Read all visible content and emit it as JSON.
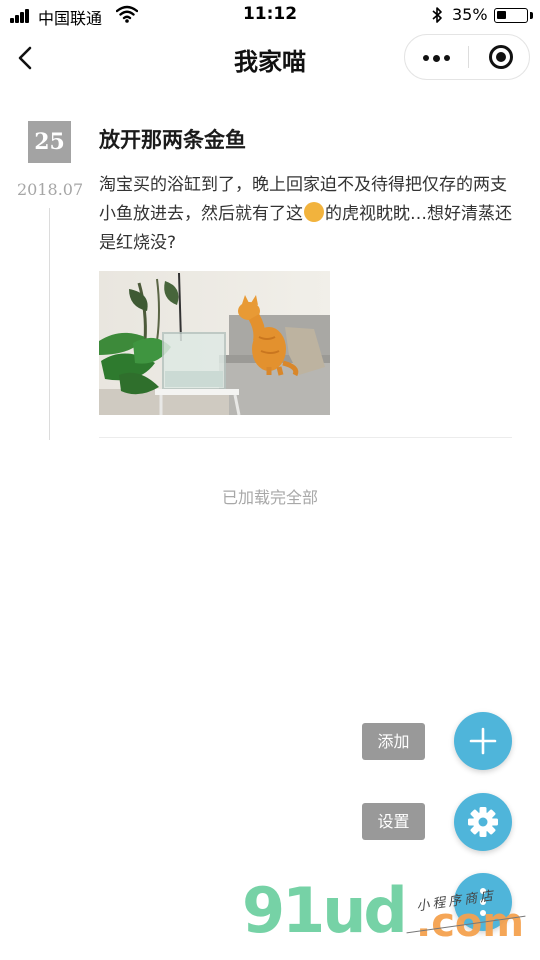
{
  "status_bar": {
    "carrier": "中国联通",
    "time": "11:12",
    "battery_text": "35%",
    "battery_level": 0.35,
    "icons": [
      "signal-icon",
      "wifi-icon",
      "bluetooth-icon",
      "battery-icon"
    ]
  },
  "nav": {
    "title": "我家喵",
    "icons": [
      "back-arrow-icon",
      "more-dots-icon",
      "close-target-icon"
    ]
  },
  "post": {
    "day": "25",
    "month": "2018.07",
    "title": "放开那两条金鱼",
    "body_before_emoji": "淘宝买的浴缸到了，晚上回家迫不及待得把仅存的两支小鱼放进去，然后就有了这",
    "body_emoji": "cat-face-emoji",
    "body_after_emoji": "的虎视眈眈…想好清蒸还是红烧没?",
    "photo": "orange-cat-watching-fish-tank-photo"
  },
  "list_footer": "已加载完全部",
  "fab": {
    "add_label": "添加",
    "settings_label": "设置",
    "icons": [
      "plus-icon",
      "gear-icon",
      "more-vertical-icon"
    ],
    "color": "#4fb5da"
  },
  "watermark": {
    "main": "91ud",
    "domain": ".com",
    "handwritten": "小程序商店"
  },
  "colors": {
    "badge": "#a3a3a3",
    "fab": "#4fb5da",
    "label_bg": "#999999"
  }
}
